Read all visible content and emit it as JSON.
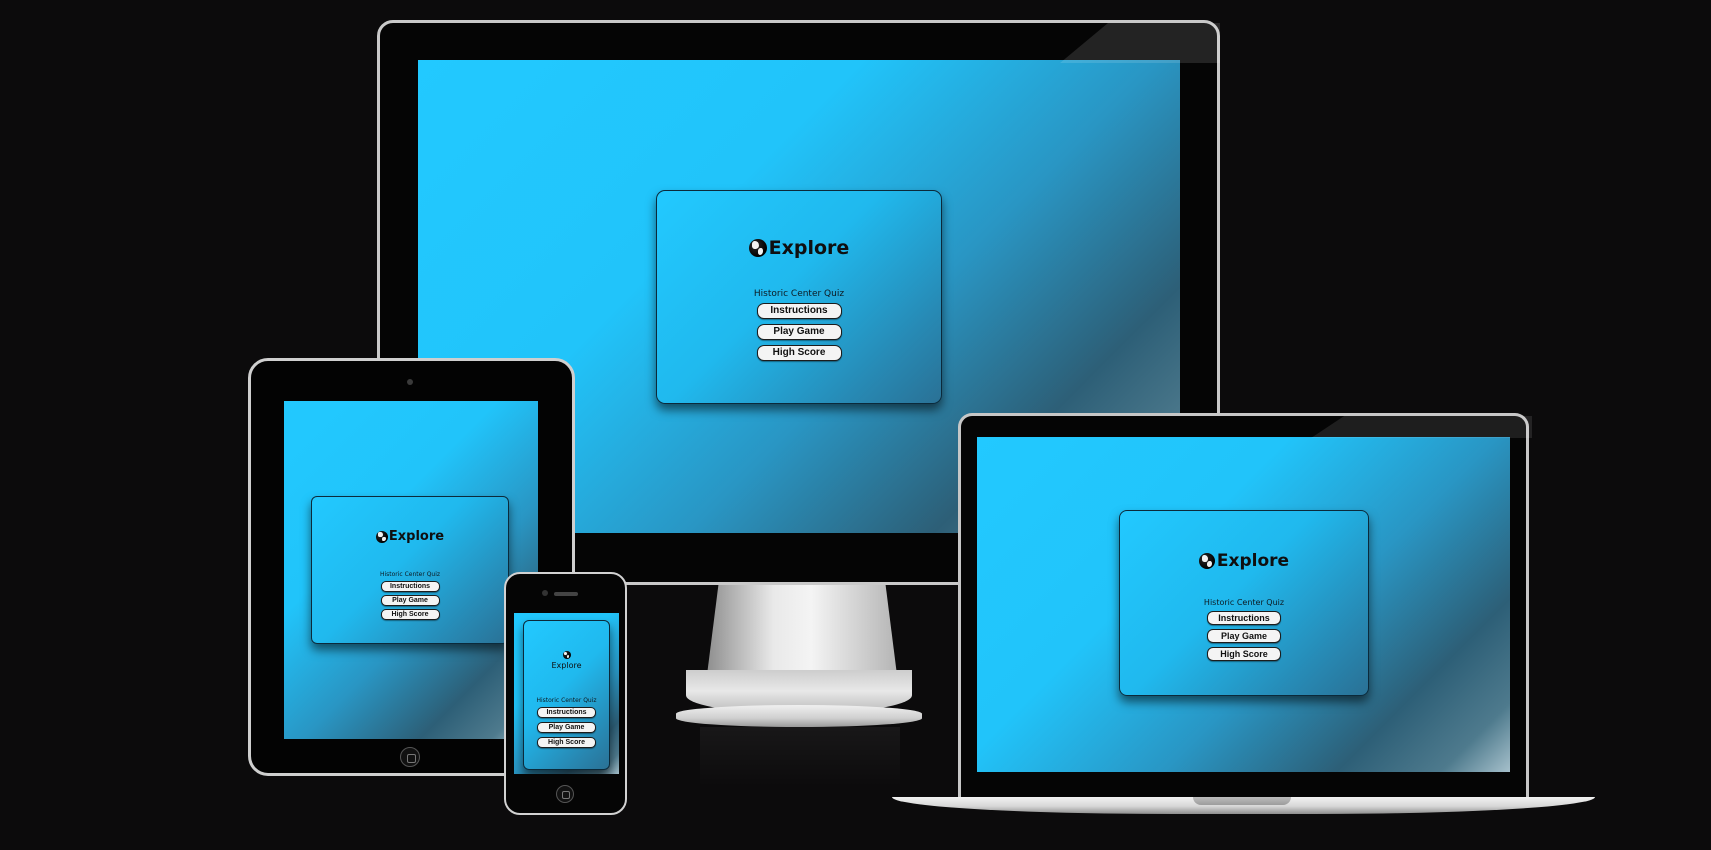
{
  "app": {
    "logo_text": "Explore",
    "subtitle": "Historic Center Quiz",
    "buttons": {
      "instructions": "Instructions",
      "play_game": "Play Game",
      "high_score": "High Score"
    }
  },
  "colors": {
    "background": "#0c0b0c",
    "screen_accent": "#22c9ff",
    "screen_dark": "#2d5f77",
    "button_bg": "#f4f4f4",
    "text_dark": "#0f0f10"
  },
  "icons": {
    "logo": "globe-icon"
  }
}
